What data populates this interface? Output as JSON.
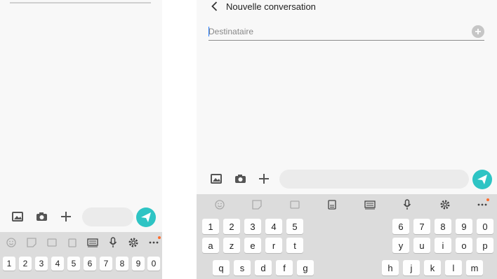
{
  "left_panel": {
    "compose": {
      "image_icon": "image-icon",
      "camera_icon": "camera-icon",
      "add_icon": "plus-icon",
      "message_placeholder": "",
      "send_icon": "send-icon"
    },
    "keyboard": {
      "toolbar": [
        "emoji-icon",
        "sticker-icon",
        "gif-icon",
        "clipboard-icon",
        "keyboard-icon",
        "mic-icon",
        "settings-icon",
        "more-icon"
      ],
      "row1": [
        "1",
        "2",
        "3",
        "4",
        "5",
        "6",
        "7",
        "8",
        "9",
        "0"
      ]
    }
  },
  "right_panel": {
    "header": {
      "back_icon": "chevron-left-icon",
      "title": "Nouvelle conversation"
    },
    "recipient": {
      "placeholder": "Destinataire",
      "value": ""
    },
    "compose": {
      "image_icon": "image-icon",
      "camera_icon": "camera-icon",
      "add_icon": "plus-icon",
      "message_placeholder": "",
      "send_icon": "send-icon"
    },
    "keyboard": {
      "toolbar": [
        "emoji-icon",
        "sticker-icon",
        "gif-icon",
        "split-keyboard-icon",
        "keyboard-icon",
        "mic-icon",
        "settings-icon",
        "more-icon"
      ],
      "left_rows": [
        [
          "1",
          "2",
          "3",
          "4",
          "5"
        ],
        [
          "a",
          "z",
          "e",
          "r",
          "t"
        ],
        [
          "q",
          "s",
          "d",
          "f",
          "g"
        ]
      ],
      "right_rows": [
        [
          "6",
          "7",
          "8",
          "9",
          "0"
        ],
        [
          "y",
          "u",
          "i",
          "o",
          "p"
        ],
        [
          "h",
          "j",
          "k",
          "l",
          "m"
        ]
      ]
    }
  },
  "colors": {
    "accent": "#2ec4c4",
    "notification_dot": "#ff6d2d",
    "background": "#f8f8f8",
    "keyboard": "#dcdcdc"
  }
}
